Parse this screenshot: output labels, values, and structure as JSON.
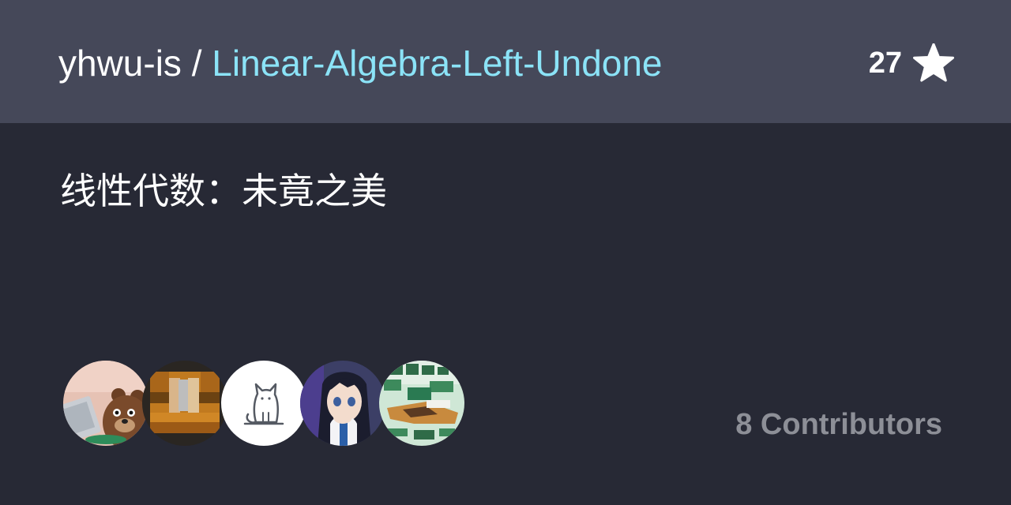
{
  "header": {
    "owner": "yhwu-is",
    "separator": " / ",
    "repo": "Linear-Algebra-Left-Undone",
    "star_count": "27",
    "star_icon": "star-icon"
  },
  "description": "线性代数：未竟之美",
  "contributors": {
    "label": "8 Contributors",
    "avatars": [
      "bear-avatar",
      "pixelated-avatar",
      "cat-avatar",
      "anime-avatar",
      "text-collage-avatar"
    ]
  },
  "colors": {
    "header_bg": "#454859",
    "body_bg": "#272935",
    "repo_accent": "#8be3f7",
    "muted_text": "#8d8f97"
  }
}
